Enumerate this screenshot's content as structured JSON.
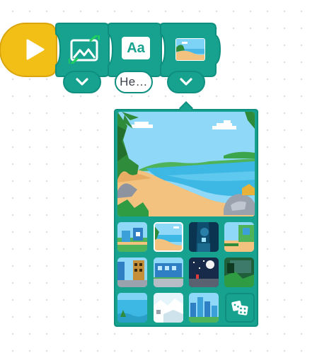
{
  "toolbar": {
    "play_icon": "play-icon",
    "image_block_icon": "image-resize-icon",
    "text_block_icon": "text-aa-icon",
    "text_block_label": "Aa",
    "background_block_icon": "background-thumbnail-icon"
  },
  "inputs": {
    "text_value": "He…"
  },
  "picker": {
    "selected_background": "beach",
    "thumbnails": [
      {
        "name": "garden-shed"
      },
      {
        "name": "beach"
      },
      {
        "name": "night-forest"
      },
      {
        "name": "porch"
      },
      {
        "name": "city-street"
      },
      {
        "name": "school"
      },
      {
        "name": "night-sky"
      },
      {
        "name": "dark-garden"
      },
      {
        "name": "underwater"
      },
      {
        "name": "snow"
      },
      {
        "name": "city-skyline"
      }
    ],
    "random_icon": "dice-icon"
  },
  "colors": {
    "accent": "#16a28e",
    "accent_dark": "#0e8f7f",
    "play": "#f2bf16"
  }
}
